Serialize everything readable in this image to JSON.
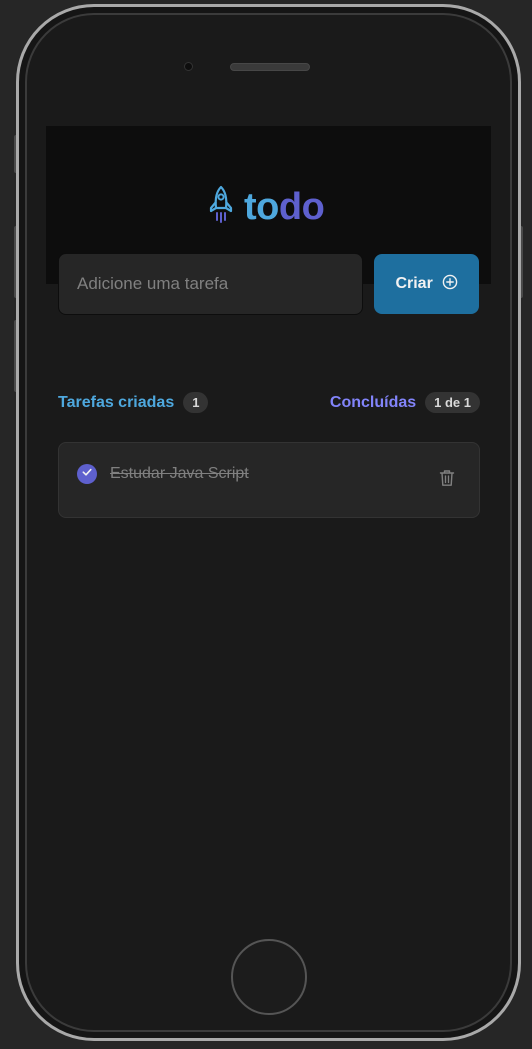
{
  "app": {
    "logo_part1": "to",
    "logo_part2": "do",
    "logo_icon": "rocket-icon"
  },
  "new_task": {
    "placeholder": "Adicione uma tarefa",
    "value": "",
    "create_label": "Criar",
    "create_icon": "plus-circle-icon"
  },
  "summary": {
    "created_label": "Tarefas criadas",
    "created_count": "1",
    "done_label": "Concluídas",
    "done_count": "1 de 1"
  },
  "tasks": [
    {
      "text": "Estudar Java Script",
      "done": true
    }
  ],
  "colors": {
    "blue": "#4ea8de",
    "purple": "#8284fa",
    "purple_dark": "#5e60ce",
    "blue_dark": "#1e6f9f",
    "background": "#1a1a1a",
    "header": "#0d0d0d"
  }
}
